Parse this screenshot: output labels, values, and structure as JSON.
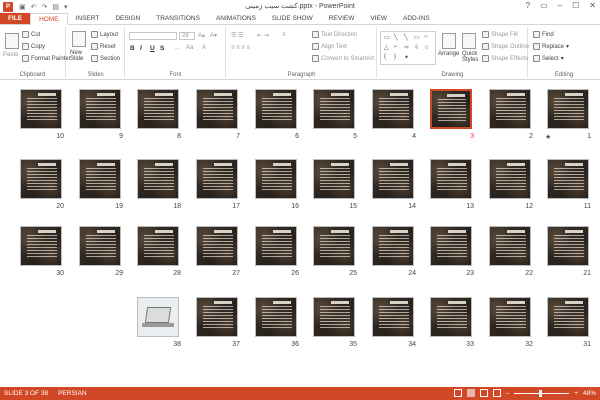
{
  "title_bar": {
    "app_icon": "P",
    "document_title": "کشت سیب زمینی.pptx - PowerPoint",
    "controls": [
      "?",
      "▭",
      "–",
      "☐",
      "✕"
    ]
  },
  "tabs": [
    "FILE",
    "HOME",
    "INSERT",
    "DESIGN",
    "TRANSITIONS",
    "ANIMATIONS",
    "SLIDE SHOW",
    "REVIEW",
    "VIEW",
    "ADD-INS"
  ],
  "ribbon": {
    "clipboard": {
      "paste": "Paste",
      "cut": "Cut",
      "copy": "Copy",
      "format_painter": "Format Painter",
      "label": "Clipboard"
    },
    "slides": {
      "new_slide": "New Slide",
      "layout": "Layout",
      "reset": "Reset",
      "section": "Section",
      "label": "Slides"
    },
    "font": {
      "font_name": "",
      "font_size": "28",
      "bold": "B",
      "italic": "I",
      "underline": "U",
      "strike": "S",
      "label": "Font"
    },
    "paragraph": {
      "text_direction": "Text Direction",
      "align_text": "Align Text",
      "convert_smartart": "Convert to SmartArt",
      "label": "Paragraph"
    },
    "drawing": {
      "arrange": "Arrange",
      "quick_styles": "Quick Styles",
      "shape_fill": "Shape Fill",
      "shape_outline": "Shape Outline",
      "shape_effects": "Shape Effects",
      "label": "Drawing"
    },
    "editing": {
      "find": "Find",
      "replace": "Replace",
      "select": "Select",
      "label": "Editing"
    }
  },
  "slides": {
    "selected": "3",
    "numbers": [
      [
        "10",
        "9",
        "8",
        "7",
        "6",
        "5",
        "4",
        "3",
        "2",
        "1"
      ],
      [
        "20",
        "19",
        "18",
        "17",
        "16",
        "15",
        "14",
        "13",
        "12",
        "11"
      ],
      [
        "30",
        "29",
        "28",
        "27",
        "26",
        "25",
        "24",
        "23",
        "22",
        "21"
      ],
      [
        "38",
        "37",
        "36",
        "35",
        "34",
        "33",
        "32",
        "31"
      ]
    ]
  },
  "status_bar": {
    "slide_info": "SLIDE 3 OF 38",
    "language": "PERSIAN",
    "zoom": "48%",
    "zoom_fraction": 0.48
  }
}
